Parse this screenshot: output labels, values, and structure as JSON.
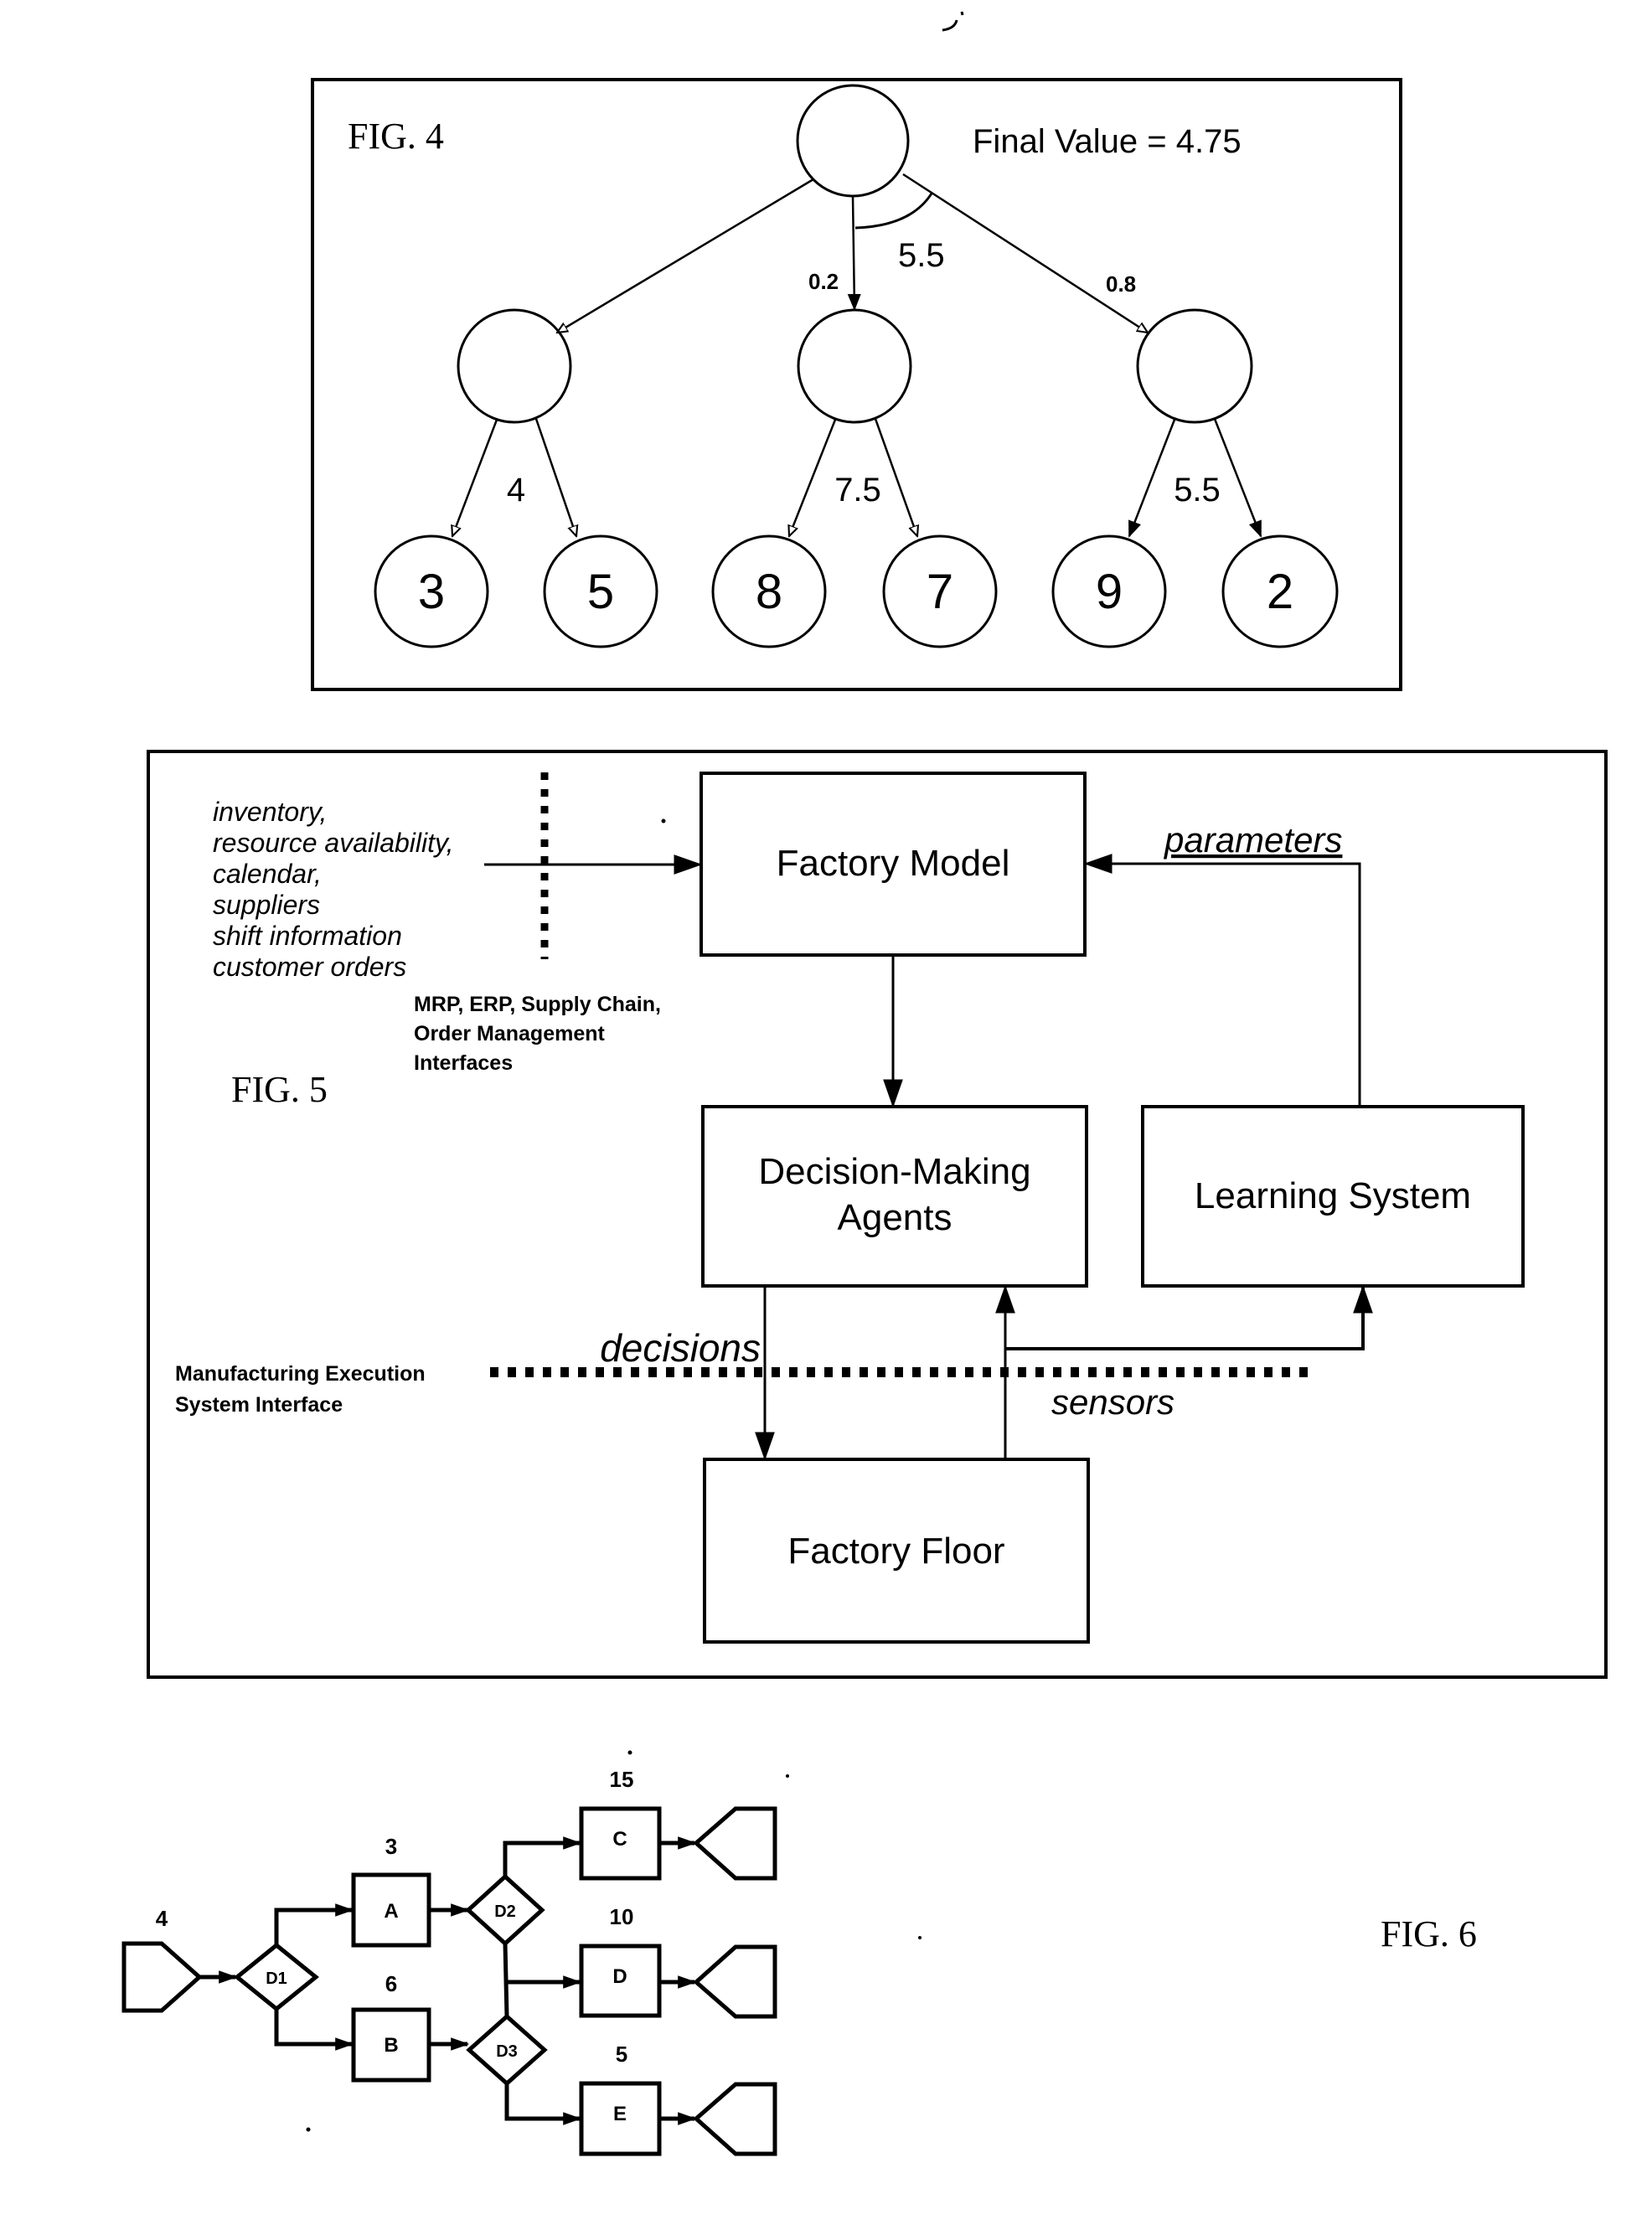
{
  "fig4": {
    "label": "FIG. 4",
    "final_value_text": "Final Value = 4.75",
    "root_annotation": "5.5",
    "branch_probabilities": {
      "middle": "0.2",
      "right": "0.8"
    },
    "internal_node_values": [
      "4",
      "7.5",
      "5.5"
    ],
    "leaf_values": [
      "3",
      "5",
      "8",
      "7",
      "9",
      "2"
    ]
  },
  "fig5": {
    "label": "FIG. 5",
    "inputs_lines": [
      "inventory,",
      "resource availability,",
      "calendar,",
      "suppliers",
      "shift information",
      "customer orders"
    ],
    "interfaces_label_lines": [
      "MRP, ERP, Supply Chain,",
      "Order Management",
      "Interfaces"
    ],
    "mes_label_lines": [
      "Manufacturing Execution",
      "System Interface"
    ],
    "boxes": {
      "factory_model": "Factory Model",
      "decision_agents_lines": [
        "Decision-Making",
        "Agents"
      ],
      "learning_system": "Learning System",
      "factory_floor": "Factory Floor"
    },
    "arrow_labels": {
      "parameters": "parameters",
      "decisions": "decisions",
      "sensors": "sensors"
    }
  },
  "fig6": {
    "label": "FIG. 6",
    "source_value": "4",
    "decision_nodes": [
      "D1",
      "D2",
      "D3"
    ],
    "tasks": [
      {
        "name": "A",
        "value": "3"
      },
      {
        "name": "B",
        "value": "6"
      },
      {
        "name": "C",
        "value": "15"
      },
      {
        "name": "D",
        "value": "10"
      },
      {
        "name": "E",
        "value": "5"
      }
    ]
  }
}
